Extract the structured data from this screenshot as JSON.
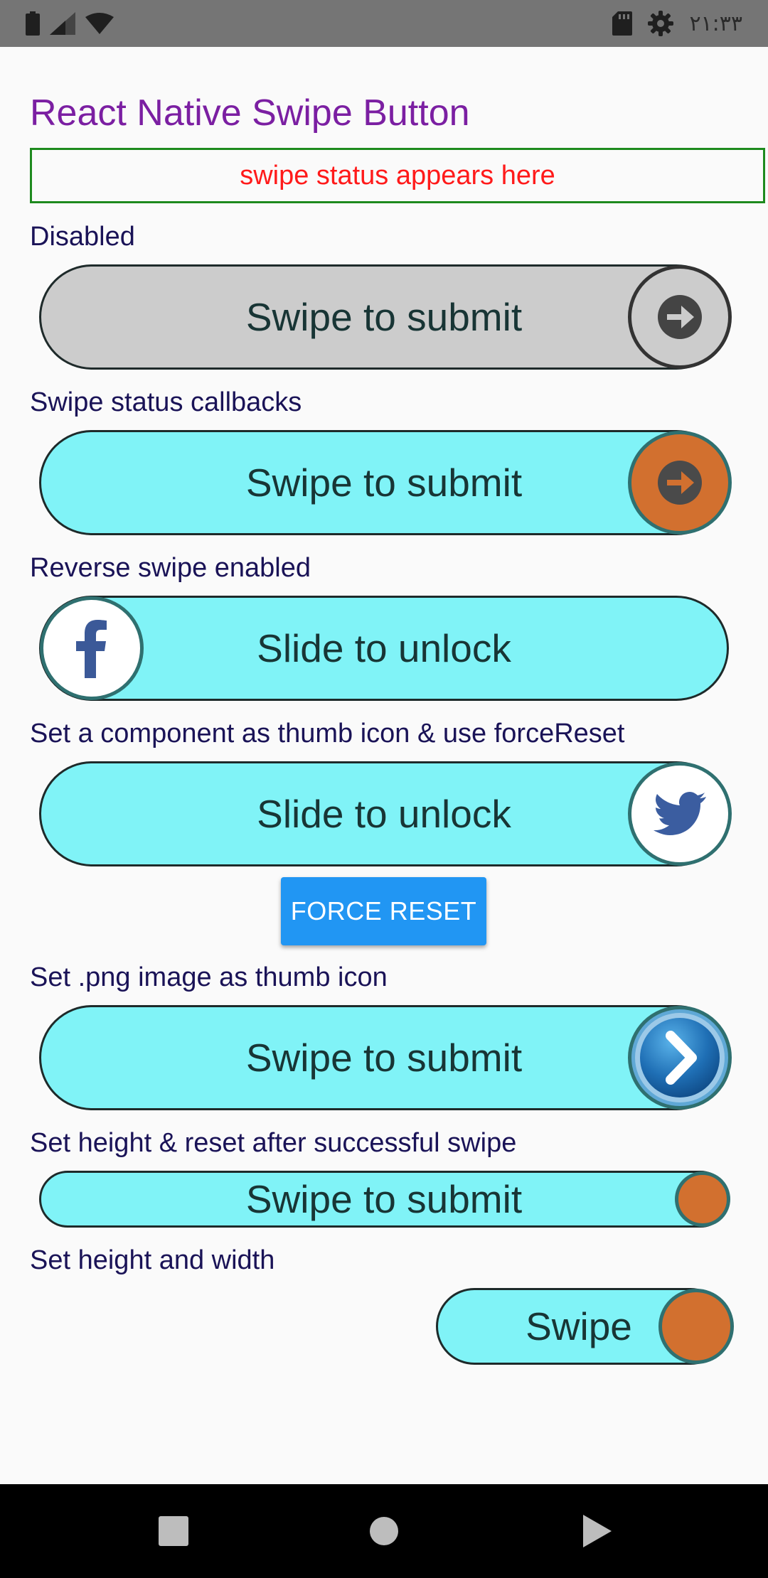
{
  "status_bar": {
    "time": "۲۱:۳۳",
    "left_icons": [
      "battery-icon",
      "signal-icon",
      "wifi-icon"
    ],
    "right_icons": [
      "sd-card-icon",
      "settings-gear-icon"
    ]
  },
  "app": {
    "title": "React Native Swipe Button",
    "swipe_status": "swipe status appears here"
  },
  "sections": [
    {
      "label": "Disabled",
      "button_title": "Swipe to submit",
      "state": "disabled",
      "thumb": "arrow-right-icon",
      "thumb_color": "#cccccc"
    },
    {
      "label": "Swipe status callbacks",
      "button_title": "Swipe to submit",
      "state": "enabled",
      "thumb": "arrow-right-icon",
      "thumb_color": "#d2702f"
    },
    {
      "label": "Reverse swipe enabled",
      "button_title": "Slide to unlock",
      "state": "enabled",
      "thumb": "facebook-icon",
      "thumb_color": "#ffffff"
    },
    {
      "label": "Set a component as thumb icon & use forceReset",
      "button_title": "Slide to unlock",
      "state": "enabled",
      "thumb": "twitter-icon",
      "thumb_color": "#ffffff"
    },
    {
      "label": "Set .png image as thumb icon",
      "button_title": "Swipe to submit",
      "state": "enabled",
      "thumb": "chevron-right-image-icon",
      "thumb_color": "#1f6fb5"
    },
    {
      "label": "Set height & reset after successful swipe",
      "button_title": "Swipe to submit",
      "state": "enabled",
      "thumb": "circle-thumb",
      "thumb_color": "#d2702f"
    },
    {
      "label": "Set height and width",
      "button_title": "Swipe",
      "state": "enabled",
      "thumb": "circle-thumb",
      "thumb_color": "#d2702f"
    }
  ],
  "force_reset_label": "FORCE RESET",
  "colors": {
    "title": "#7b1fa2",
    "status_text": "#ff1a1a",
    "status_border": "#1e8a1e",
    "rail_enabled": "#80f3f7",
    "rail_disabled": "#cccccc",
    "thumb_orange": "#d2702f",
    "force_reset_button": "#2196f3"
  },
  "nav_bar": [
    "recents-square-icon",
    "home-circle-icon",
    "back-triangle-icon"
  ]
}
